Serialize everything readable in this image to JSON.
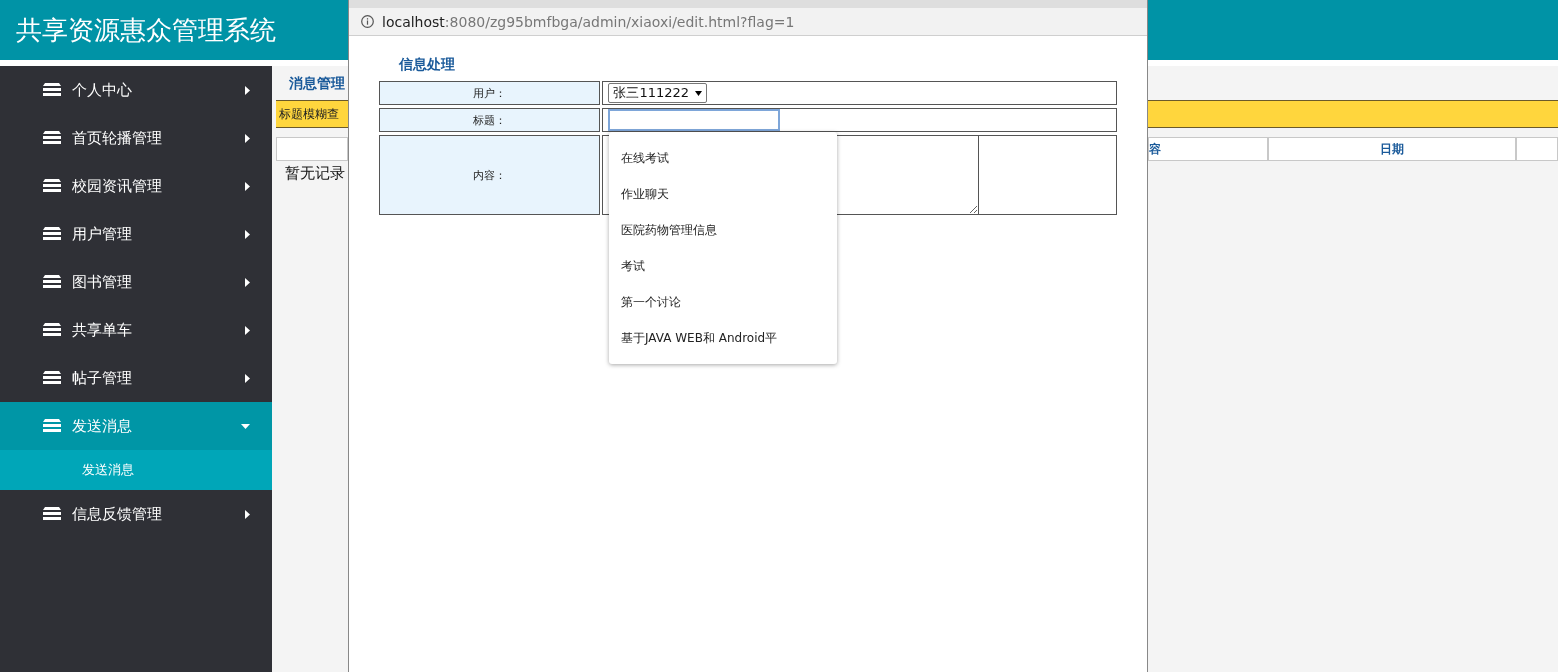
{
  "header": {
    "title": "共享资源惠众管理系统"
  },
  "sidebar": {
    "items": [
      {
        "label": "个人中心",
        "selected": false,
        "expanded": false
      },
      {
        "label": "首页轮播管理",
        "selected": false,
        "expanded": false
      },
      {
        "label": "校园资讯管理",
        "selected": false,
        "expanded": false
      },
      {
        "label": "用户管理",
        "selected": false,
        "expanded": false
      },
      {
        "label": "图书管理",
        "selected": false,
        "expanded": false
      },
      {
        "label": "共享单车",
        "selected": false,
        "expanded": false
      },
      {
        "label": "帖子管理",
        "selected": false,
        "expanded": false
      },
      {
        "label": "发送消息",
        "selected": true,
        "expanded": true,
        "children": [
          {
            "label": "发送消息",
            "selected": true
          }
        ]
      },
      {
        "label": "信息反馈管理",
        "selected": false,
        "expanded": false
      }
    ]
  },
  "main": {
    "section_title": "消息管理",
    "search_bar": {
      "label": "标题模糊查"
    },
    "table": {
      "columns": [
        "",
        "容",
        "日期",
        ""
      ],
      "empty_text": "暂无记录"
    }
  },
  "popup": {
    "address_bar": {
      "host": "localhost",
      "path": ":8080/zg95bmfbga/admin/xiaoxi/edit.html?flag=1"
    },
    "heading": "信息处理",
    "fields": [
      {
        "kind": "select",
        "label": "用户：",
        "value": "张三111222"
      },
      {
        "kind": "text",
        "label": "标题：",
        "focused": true
      },
      {
        "kind": "textarea",
        "label": "内容："
      }
    ],
    "autocomplete": {
      "items": [
        "在线考试",
        "作业聊天",
        "医院药物管理信息",
        "考试",
        "第一个讨论",
        "基于JAVA WEB和 Android平"
      ]
    }
  }
}
